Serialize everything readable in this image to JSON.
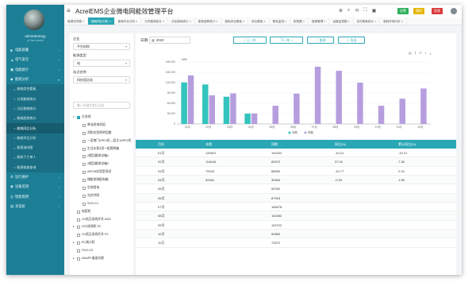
{
  "app": {
    "title": "AcrelEMS企业微电网能效管理平台",
    "badges": [
      "告警",
      "通知",
      "异常"
    ]
  },
  "user": {
    "name": "adminEnergy",
    "status": "● Has loaded"
  },
  "sidebar": {
    "items": [
      {
        "label": "电能质量",
        "icon": "■",
        "expanded": false
      },
      {
        "label": "电气安全",
        "icon": "▲",
        "expanded": false
      },
      {
        "label": "电能统计",
        "icon": "▣",
        "expanded": false
      },
      {
        "label": "能耗分析",
        "icon": "◆",
        "expanded": true
      }
    ],
    "subitems": [
      {
        "label": "能耗综合看板",
        "active": false
      },
      {
        "label": "分项能耗统计",
        "active": false
      },
      {
        "label": "分区能耗统计",
        "active": false
      },
      {
        "label": "能耗趋势统计",
        "active": false
      },
      {
        "label": "能耗同比分析",
        "active": true
      },
      {
        "label": "能耗环比分析",
        "active": false
      },
      {
        "label": "能源流向图",
        "active": false
      },
      {
        "label": "能耗下工单人",
        "active": false
      },
      {
        "label": "能源抽查查询",
        "active": false
      }
    ],
    "bottom": [
      {
        "label": "运行维护",
        "icon": "⚙"
      },
      {
        "label": "设备监测",
        "icon": "◉"
      },
      {
        "label": "智能照明",
        "icon": "◎"
      },
      {
        "label": "充电桩",
        "icon": "▤"
      }
    ]
  },
  "tabs": [
    {
      "label": "能源流向图",
      "active": false
    },
    {
      "label": "能耗同比分析",
      "active": true
    },
    {
      "label": "能耗环比分析",
      "active": false
    },
    {
      "label": "分项能耗统计",
      "active": false
    },
    {
      "label": "分区能耗统计",
      "active": false
    },
    {
      "label": "能耗趋势统计",
      "active": false
    },
    {
      "label": "能耗综合看板",
      "active": false
    },
    {
      "label": "综合看板",
      "active": false
    },
    {
      "label": "配电监测",
      "active": false
    },
    {
      "label": "配电图",
      "active": false
    },
    {
      "label": "能源管理",
      "active": false
    },
    {
      "label": "运营监视图",
      "active": false
    },
    {
      "label": "实时能耗统计",
      "active": false
    },
    {
      "label": "能耗环境分析",
      "active": false
    }
  ],
  "filter": {
    "enterprise_label": "企业",
    "enterprise_value": "平台机构",
    "energy_label": "能源类型",
    "energy_value": "电",
    "station_label": "站点名称",
    "station_value": "科技园总站",
    "search_placeholder": "输入关键字进行过滤"
  },
  "tree": [
    {
      "label": "主进线",
      "level": 0,
      "toggle": "▾",
      "checked": true
    },
    {
      "label": "柴油发电机组",
      "level": 1,
      "toggle": "",
      "checked": false
    },
    {
      "label": "消防应急照明回路",
      "level": 1,
      "toggle": "",
      "checked": false
    },
    {
      "label": "一层南门APE1柜—层主1APE1柜",
      "level": 1,
      "toggle": "",
      "checked": false
    },
    {
      "label": "生活水泵3用一组照明箱",
      "level": 1,
      "toggle": "",
      "checked": false
    },
    {
      "label": "2楼回路测试箱1",
      "level": 1,
      "toggle": "",
      "checked": false
    },
    {
      "label": "2楼回路测试箱2",
      "level": 1,
      "toggle": "",
      "checked": false
    },
    {
      "label": "ARCM实验室测试",
      "level": 1,
      "toggle": "",
      "checked": false
    },
    {
      "label": "储能系统配电箱",
      "level": 1,
      "toggle": "",
      "checked": false
    },
    {
      "label": "空调用电",
      "level": 1,
      "toggle": "",
      "checked": false
    },
    {
      "label": "光伏并网",
      "level": 1,
      "toggle": "",
      "checked": false
    },
    {
      "label": "SVG-C1",
      "level": 1,
      "toggle": "",
      "checked": false
    },
    {
      "label": "电容柜",
      "level": 0,
      "toggle": "",
      "checked": false
    },
    {
      "label": "G1低压进线开关 ASD",
      "level": 0,
      "toggle": "",
      "checked": false
    },
    {
      "label": "2G2进线柜 P2",
      "level": 0,
      "toggle": "▸",
      "checked": false
    },
    {
      "label": "G1低压进线开关 P2",
      "level": 0,
      "toggle": "",
      "checked": false
    },
    {
      "label": "EC演示柜",
      "level": 0,
      "toggle": "▸",
      "checked": false
    },
    {
      "label": "SVG-C3",
      "level": 0,
      "toggle": "",
      "checked": false
    },
    {
      "label": "ANAPF谐波治理",
      "level": 0,
      "toggle": "▸",
      "checked": false
    }
  ],
  "toolbar": {
    "date_label": "日期:",
    "date_value": "2022",
    "prev_label": "< 上一年",
    "next_label": "下一年 >",
    "query_label": "◯ 查询",
    "export_label": "⇩ 导出",
    "tool_icons": [
      "▤",
      "⫿",
      "⟲",
      "⌕",
      "⤓"
    ]
  },
  "chart_data": {
    "type": "bar",
    "unit": "kWh",
    "categories": [
      "01月",
      "02月",
      "03月",
      "04月",
      "05月",
      "06月",
      "07月",
      "08月",
      "09月",
      "10月",
      "11月",
      "12月"
    ],
    "series": [
      {
        "name": "本期",
        "color": "#34c3bd",
        "values": [
          120622,
          114646,
          79104,
          30062,
          0,
          0,
          0,
          0,
          0,
          0,
          0,
          0
        ]
      },
      {
        "name": "同期",
        "color": "#b69ede",
        "values": [
          141022,
          83070,
          88650,
          30364,
          52932,
          87918,
          166078,
          154352,
          119702,
          52860,
          73372,
          103000
        ]
      }
    ],
    "ylim": [
      0,
      180000
    ],
    "yticks": [
      "180,000",
      "150,000",
      "120,000",
      "90,000",
      "60,000",
      "30,000",
      "0"
    ],
    "legend": "bottom-center"
  },
  "table": {
    "headers": [
      "月份",
      "本期",
      "同期",
      "同比(%)",
      "累计同比(%)"
    ],
    "rows": [
      [
        "01月",
        "120622",
        "141022",
        "-10.21",
        "-10.21"
      ],
      [
        "02月",
        "114646",
        "83070",
        "37.02",
        "7.38"
      ],
      [
        "03月",
        "79104",
        "88650",
        "-10.77",
        "2.24"
      ],
      [
        "04月",
        "30062",
        "30364",
        "-0.99",
        "1.96"
      ],
      [
        "05月",
        "",
        "52932",
        "",
        ""
      ],
      [
        "06月",
        "",
        "87918",
        "",
        ""
      ],
      [
        "07月",
        "",
        "166078",
        "",
        ""
      ],
      [
        "08月",
        "",
        "154352",
        "",
        ""
      ],
      [
        "09月",
        "",
        "119702",
        "",
        ""
      ],
      [
        "10月",
        "",
        "52860",
        "",
        ""
      ],
      [
        "11月",
        "",
        "73372",
        "",
        ""
      ]
    ]
  }
}
